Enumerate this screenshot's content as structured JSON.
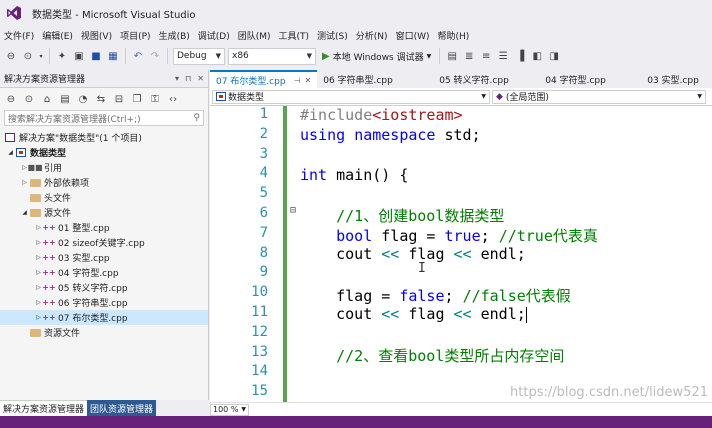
{
  "window": {
    "title": "数据类型 - Microsoft Visual Studio"
  },
  "menu": [
    "文件(F)",
    "编辑(E)",
    "视图(V)",
    "项目(P)",
    "生成(B)",
    "调试(D)",
    "团队(M)",
    "工具(T)",
    "测试(S)",
    "分析(N)",
    "窗口(W)",
    "帮助(H)"
  ],
  "toolbar": {
    "config": "Debug",
    "platform": "x86",
    "run_label": "本地 Windows 调试器"
  },
  "solution_explorer": {
    "title": "解决方案资源管理器",
    "search_placeholder": "搜索解决方案资源管理器(Ctrl+;)",
    "solution_label": "解决方案\"数据类型\"(1 个项目)",
    "project_label": "数据类型",
    "items": [
      {
        "label": "引用",
        "kind": "ref",
        "level": 2,
        "expander": "▷"
      },
      {
        "label": "外部依赖项",
        "kind": "folder",
        "level": 2,
        "expander": "▷"
      },
      {
        "label": "头文件",
        "kind": "folder",
        "level": 2,
        "expander": ""
      },
      {
        "label": "源文件",
        "kind": "folder",
        "level": 2,
        "expander": "◢"
      },
      {
        "label": "01 整型.cpp",
        "kind": "cpp",
        "level": 3,
        "expander": "▷"
      },
      {
        "label": "02 sizeof关键字.cpp",
        "kind": "cpp",
        "level": 3,
        "expander": "▷"
      },
      {
        "label": "03 实型.cpp",
        "kind": "cpp",
        "level": 3,
        "expander": "▷"
      },
      {
        "label": "04 字符型.cpp",
        "kind": "cpp",
        "level": 3,
        "expander": "▷"
      },
      {
        "label": "05 转义字符.cpp",
        "kind": "cpp",
        "level": 3,
        "expander": "▷"
      },
      {
        "label": "06 字符串型.cpp",
        "kind": "cpp",
        "level": 3,
        "expander": "▷"
      },
      {
        "label": "07 布尔类型.cpp",
        "kind": "cpp",
        "level": 3,
        "expander": "▷",
        "selected": true
      },
      {
        "label": "资源文件",
        "kind": "folder",
        "level": 2,
        "expander": ""
      }
    ]
  },
  "panel_tabs": {
    "active": "解决方案资源管理器",
    "inactive": "团队资源管理器"
  },
  "doc_tabs": [
    {
      "label": "07 布尔类型.cpp",
      "active": true
    },
    {
      "label": "06 字符串型.cpp"
    },
    {
      "label": "05 转义字符.cpp"
    },
    {
      "label": "04 字符型.cpp"
    },
    {
      "label": "03 实型.cpp"
    }
  ],
  "nav_bar": {
    "scope": "数据类型",
    "member": "(全局范围)"
  },
  "editor": {
    "line_numbers": [
      "1",
      "2",
      "3",
      "4",
      "5",
      "6",
      "7",
      "8",
      "9",
      "10",
      "11",
      "12",
      "13",
      "14",
      "15"
    ],
    "zoom": "100 %"
  },
  "watermark": "https://blog.csdn.net/lidew521",
  "colors": {
    "accent": "#007acc",
    "statusbar": "#68217a",
    "keyword": "#0000ff",
    "comment": "#008000",
    "line_number": "#2b91af"
  }
}
